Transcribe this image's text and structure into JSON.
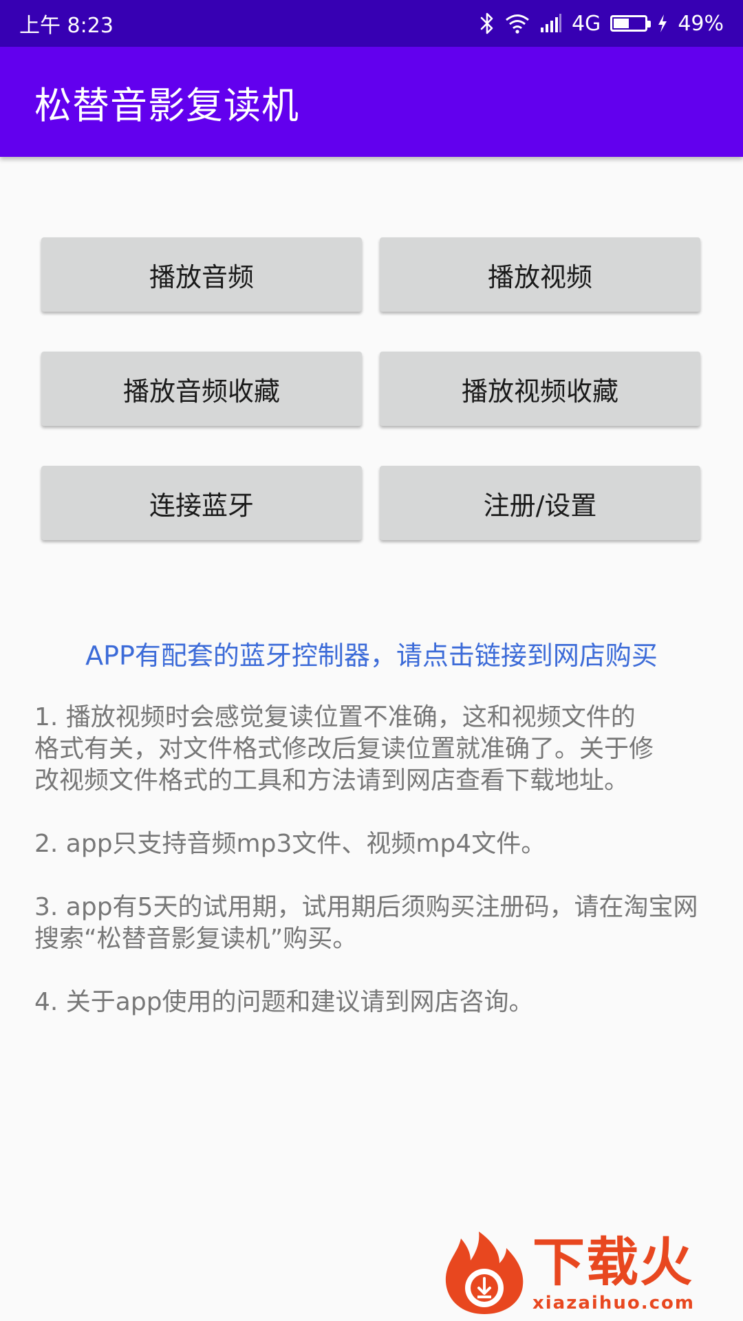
{
  "status_bar": {
    "time": "上午 8:23",
    "network": "4G",
    "battery_level": 0.49,
    "battery_text": "49%",
    "icons": [
      "bluetooth-icon",
      "wifi-icon",
      "signal-icon",
      "battery-icon",
      "charging-icon"
    ]
  },
  "app_bar": {
    "title": "松替音影复读机",
    "color": "#6200ee",
    "status_color": "#3700b3"
  },
  "buttons": {
    "play_audio": "播放音频",
    "play_video": "播放视频",
    "audio_favorites": "播放音频收藏",
    "video_favorites": "播放视频收藏",
    "connect_bluetooth": "连接蓝牙",
    "register_settings": "注册/设置"
  },
  "shop_link": {
    "text": "APP有配套的蓝牙控制器，请点击链接到网店购买",
    "color": "#3c6bd8"
  },
  "notes": [
    "1. 播放视频时会感觉复读位置不准确，这和视频文件的格式有关，对文件格式修改后复读位置就准确了。关于修改视频文件格式的工具和方法请到网店查看下载地址。",
    "2. app只支持音频mp3文件、视频mp4文件。",
    "3. app有5天的试用期，试用期后须购买注册码，请在淘宝网搜索“松替音影复读机”购买。",
    "4. 关于app使用的问题和建议请到网店咨询。"
  ],
  "watermark": {
    "title": "下载火",
    "subtitle": "xiazaihuo.com",
    "color": "#e8471f"
  }
}
